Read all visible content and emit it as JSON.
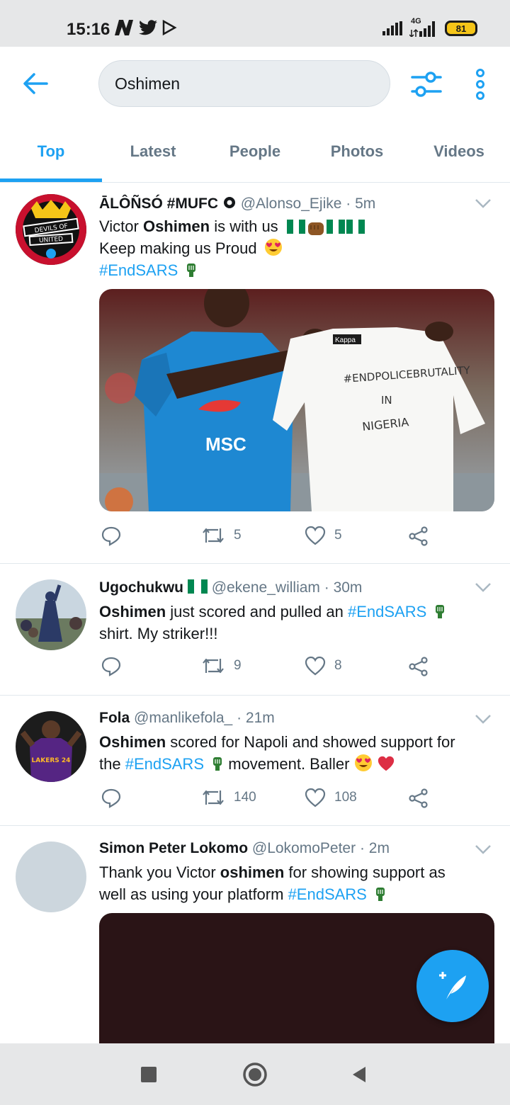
{
  "status_bar": {
    "time": "15:16",
    "network": "4G",
    "battery": "81"
  },
  "search": {
    "value": "Oshimen"
  },
  "tabs": [
    {
      "label": "Top"
    },
    {
      "label": "Latest"
    },
    {
      "label": "People"
    },
    {
      "label": "Photos"
    },
    {
      "label": "Videos"
    }
  ],
  "tweets": [
    {
      "name": "ĀLÔÑSÓ #MUFC",
      "handle": "@Alonso_Ejike",
      "time": "· 5m",
      "avatar_text": "DEVILS OF UNITED",
      "line1_pre": "Victor ",
      "line1_bold": "Oshimen",
      "line1_post": " is with us",
      "line2": "Keep making us Proud",
      "hashtag": "#EndSARS",
      "media_text": [
        "Kappa",
        "#ENDPOLICEBRUTALITY",
        "IN",
        "NIGERIA",
        "MSC"
      ],
      "retweets": "5",
      "likes": "5"
    },
    {
      "name": "Ugochukwu",
      "handle": "@ekene_william",
      "time": "· 30m",
      "line1_bold": "Oshimen",
      "line1_post": " just scored and pulled an ",
      "hashtag": "#EndSARS",
      "line2": "shirt. My striker!!!",
      "retweets": "9",
      "likes": "8"
    },
    {
      "name": "Fola",
      "handle": "@manlikefola_",
      "time": "· 21m",
      "avatar_text": "LAKERS 24",
      "line1_bold": "Oshimen",
      "line1_post": " scored for Napoli and showed support for",
      "line2_pre": "the ",
      "hashtag": "#EndSARS",
      "line2_post": " movement. Baller",
      "retweets": "140",
      "likes": "108"
    },
    {
      "name": "Simon Peter Lokomo",
      "handle": "@LokomoPeter",
      "time": "· 2m",
      "line1_pre": "Thank you Victor ",
      "line1_bold": "oshimen",
      "line1_post": " for showing support as",
      "line2_pre": "well as using your platform ",
      "hashtag": "#EndSARS"
    }
  ],
  "colors": {
    "accent": "#1da1f2",
    "text": "#14171a",
    "secondary": "#657786",
    "statusbar": "#e6e7e8"
  }
}
